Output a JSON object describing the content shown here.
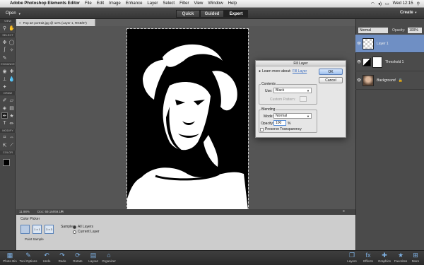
{
  "menubar": {
    "app_name": "Adobe Photoshop Elements Editor",
    "items": [
      "File",
      "Edit",
      "Image",
      "Enhance",
      "Layer",
      "Select",
      "Filter",
      "View",
      "Window",
      "Help"
    ],
    "clock": "Wed 12:15"
  },
  "appbar": {
    "open_label": "Open",
    "modes": [
      "Quick",
      "Guided",
      "Expert"
    ],
    "active_mode": "Expert",
    "create_label": "Create"
  },
  "toolbar": {
    "sections": [
      "VIEW",
      "SELECT",
      "ENHANCE",
      "DRAW",
      "MODIFY",
      "COLOR"
    ]
  },
  "document": {
    "tab_title": "Pop art portrait.jpg @ 12% (Layer 1, RGB/8*)",
    "zoom": "11.98%",
    "doc_size": "Doc: 69.1M/69.1M"
  },
  "tool_options": {
    "tool_name": "Color Picker",
    "sample_sizes": [
      "1 x 1",
      "3 x 3",
      "5 x 5"
    ],
    "sample_size_caption": "Point Sample",
    "sample_label": "Sample:",
    "sample_options": [
      "All Layers",
      "Current Layer"
    ]
  },
  "layers_panel": {
    "blend_mode": "Normal",
    "opacity_label": "Opacity:",
    "opacity_value": "100%",
    "layers": [
      {
        "name": "Layer 1"
      },
      {
        "name": "Threshold 1"
      },
      {
        "name": "Background"
      }
    ]
  },
  "dialog": {
    "title": "Fill Layer",
    "learn_more_label": "Learn more about:",
    "learn_more_link": "Fill Layer",
    "ok_label": "OK",
    "cancel_label": "Cancel",
    "contents_label": "Contents",
    "use_label": "Use:",
    "use_value": "Black",
    "custom_pattern_label": "Custom Pattern:",
    "blending_label": "Blending",
    "mode_label": "Mode:",
    "mode_value": "Normal",
    "opacity_label": "Opacity:",
    "opacity_value": "100",
    "opacity_unit": "%",
    "preserve_label": "Preserve Transparency"
  },
  "bottombar": {
    "left": [
      "Photo Bin",
      "Tool Options",
      "Undo",
      "Redo",
      "Rotate",
      "Layout",
      "Organizer"
    ],
    "right": [
      "Layers",
      "Effects",
      "Graphics",
      "Favorites",
      "More"
    ]
  }
}
